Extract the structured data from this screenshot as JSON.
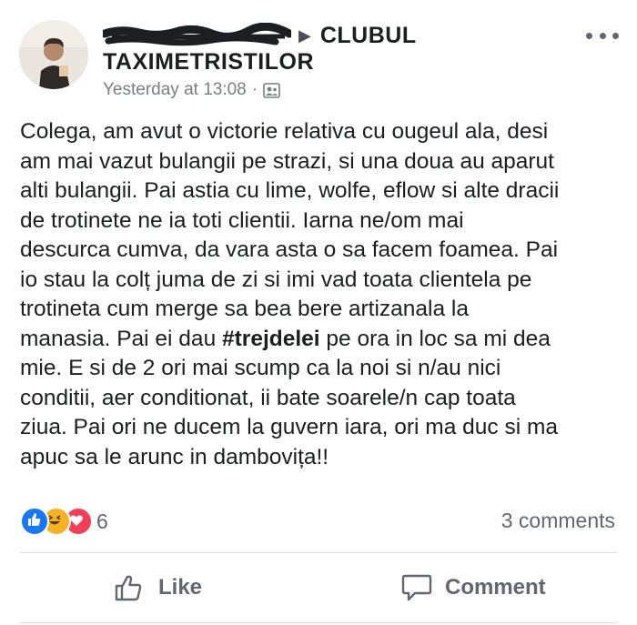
{
  "header": {
    "group_name_line1": "CLUBUL",
    "group_name_line2": "TAXIMETRISTILOR",
    "timestamp": "Yesterday at 13:08",
    "separator": "·"
  },
  "post": {
    "lines": [
      "Colega, am avut o victorie relativa cu ougeul ala, desi",
      "am mai vazut bulangii pe strazi, si una doua au aparut",
      "alti bulangii. Pai astia cu lime, wolfe, eflow si alte dracii",
      "de trotinete ne ia toti clientii. Iarna ne/om mai",
      "descurca cumva, da vara asta o sa facem foamea. Pai",
      "io stau la colț juma de zi si imi vad toata clientela pe",
      "trotineta cum merge sa bea bere artizanala la",
      "manasia. Pai ei dau ",
      " pe ora in loc sa mi dea",
      "mie. E si de 2 ori mai scump ca la noi si n/au nici",
      "conditii, aer conditionat,  ii bate soarele/n cap toata",
      "ziua.  Pai ori ne ducem la guvern iara, ori ma duc si ma",
      "apuc sa le arunc in dambovița!!"
    ],
    "hashtag": "#trejdelei"
  },
  "engagement": {
    "reaction_count": "6",
    "comments": "3 comments"
  },
  "actions": {
    "like": "Like",
    "comment": "Comment"
  },
  "colors": {
    "like_blue": "#1877f2",
    "haha_yellow": "#f7b125",
    "love_red": "#f33e58",
    "text": "#1c1e21",
    "secondary": "#606770"
  }
}
